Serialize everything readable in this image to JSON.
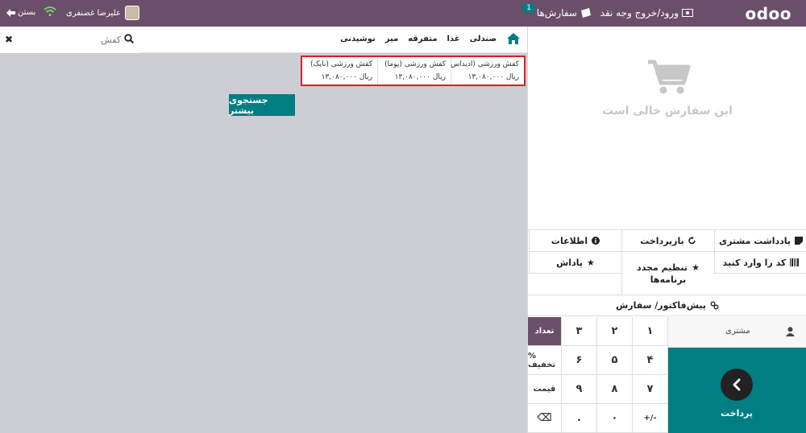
{
  "header": {
    "logo": "odoo",
    "cash_label": "ورود/خروج وجه نقد",
    "orders_label": "سفارش‌ها",
    "orders_count": "1",
    "user_name": "علیرضا غضنفری",
    "close_label": "بستن"
  },
  "search": {
    "value": "کفش"
  },
  "categories": [
    "صندلی",
    "غذا",
    "متفرقه",
    "میز",
    "نوشیدنی"
  ],
  "products": [
    {
      "name": "کفش ورزشی (ادیداس)",
      "price": "۱۳,۰۸۰,۰۰۰ ریال"
    },
    {
      "name": "کفش ورزشی (پوما)",
      "price": "۱۳,۰۸۰,۰۰۰ ریال"
    },
    {
      "name": "کفش ورزشی (نایک)",
      "price": "۱۳,۰۸۰,۰۰۰ ریال"
    }
  ],
  "more_search": "جستجوی بیشتر",
  "order": {
    "empty_text": "این سفارش خالی است"
  },
  "actions": {
    "customer_note": "یادداشت مشتری",
    "refund": "بازپرداخت",
    "info": "اطلاعات",
    "enter_code": "کد را وارد کنید",
    "reset_programs_1": "تنظیم مجدد",
    "reset_programs_2": "برنامه‌ها",
    "reward": "پاداش",
    "proforma": "پیش‌فاکتور/ سفارش"
  },
  "customer_label": "مشتری",
  "payment_label": "پرداخت",
  "numpad": {
    "k1": "۱",
    "k2": "۲",
    "k3": "۳",
    "qty": "تعداد",
    "k4": "۴",
    "k5": "۵",
    "k6": "۶",
    "disc": "% تخفیف",
    "k7": "۷",
    "k8": "۸",
    "k9": "۹",
    "price": "قیمت",
    "sign": "+/-",
    "k0": "۰",
    "dot": ".",
    "backspace": "⌫"
  },
  "colors": {
    "brand": "#6b4e6a",
    "teal": "#017e84",
    "highlight": "#e01b24"
  }
}
